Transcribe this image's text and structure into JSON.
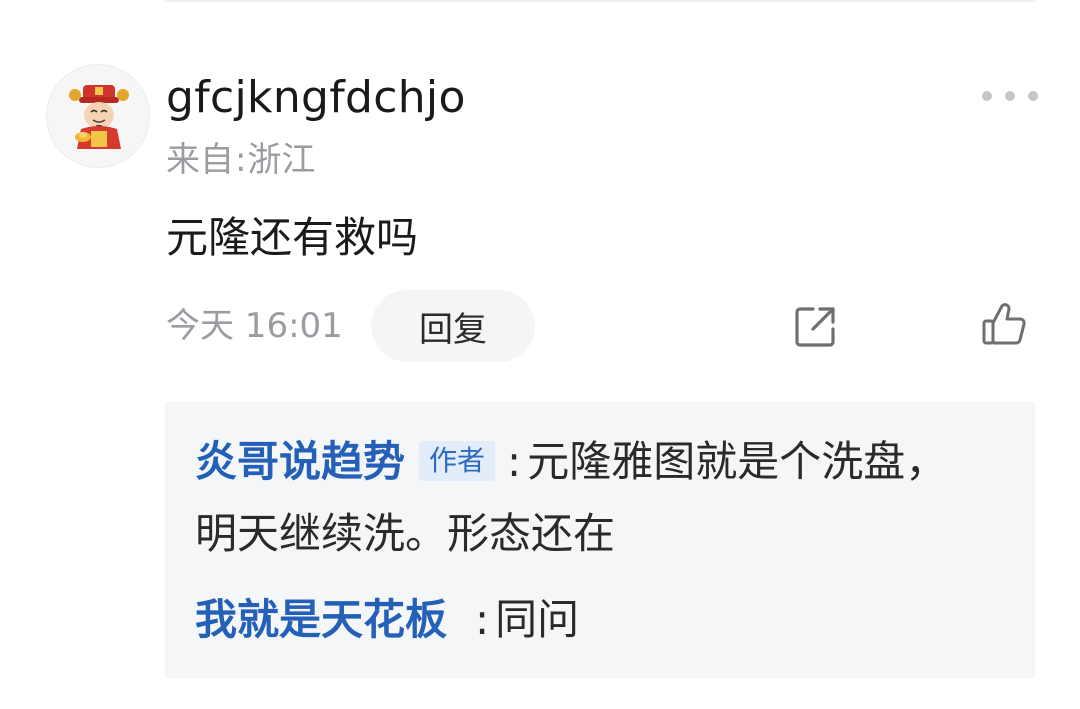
{
  "comment": {
    "username": "gfcjkngfdchjo",
    "location_prefix": "来自",
    "location_separator": ":",
    "location": "浙江",
    "text": "元隆还有救吗",
    "time": "今天 16:01",
    "reply_label": "回复",
    "avatar_icon": "fortune-god-avatar",
    "more_icon": "more-dots-icon",
    "share_icon": "share-icon",
    "like_icon": "thumbs-up-icon"
  },
  "replies": [
    {
      "author": "炎哥说趋势",
      "badge": "作者",
      "separator": ":",
      "text": "元隆雅图就是个洗盘，明天继续洗。形态还在"
    },
    {
      "author": "我就是天花板",
      "separator": ":",
      "text": "同问"
    }
  ],
  "colors": {
    "author_link": "#2460b8",
    "badge_bg": "#e3ecf9",
    "muted_text": "#9b9ba1",
    "reply_box_bg": "#f5f6f8"
  }
}
